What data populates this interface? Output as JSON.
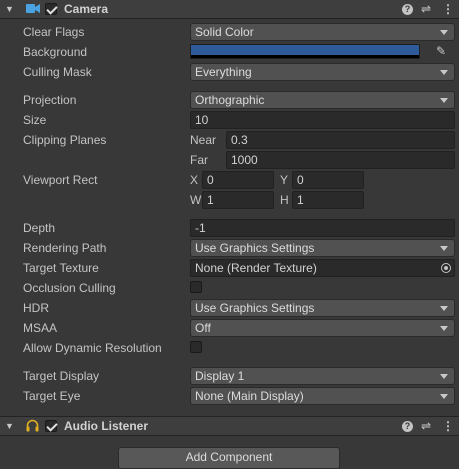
{
  "camera": {
    "title": "Camera",
    "enabled": true,
    "icons": [
      "camera-icon",
      "help-icon",
      "preset-icon",
      "more-icon"
    ],
    "clear_flags": {
      "label": "Clear Flags",
      "value": "Solid Color"
    },
    "background": {
      "label": "Background",
      "color": "#2f5a99"
    },
    "culling_mask": {
      "label": "Culling Mask",
      "value": "Everything"
    },
    "projection": {
      "label": "Projection",
      "value": "Orthographic"
    },
    "size": {
      "label": "Size",
      "value": "10"
    },
    "clipping": {
      "label": "Clipping Planes",
      "near_label": "Near",
      "near": "0.3",
      "far_label": "Far",
      "far": "1000"
    },
    "viewport": {
      "label": "Viewport Rect",
      "x_label": "X",
      "x": "0",
      "y_label": "Y",
      "y": "0",
      "w_label": "W",
      "w": "1",
      "h_label": "H",
      "h": "1"
    },
    "depth": {
      "label": "Depth",
      "value": "-1"
    },
    "rendering_path": {
      "label": "Rendering Path",
      "value": "Use Graphics Settings"
    },
    "target_texture": {
      "label": "Target Texture",
      "value": "None (Render Texture)"
    },
    "occlusion_culling": {
      "label": "Occlusion Culling",
      "checked": false
    },
    "hdr": {
      "label": "HDR",
      "value": "Use Graphics Settings"
    },
    "msaa": {
      "label": "MSAA",
      "value": "Off"
    },
    "dynamic_resolution": {
      "label": "Allow Dynamic Resolution",
      "checked": false
    },
    "target_display": {
      "label": "Target Display",
      "value": "Display 1"
    },
    "target_eye": {
      "label": "Target Eye",
      "value": "None (Main Display)"
    }
  },
  "audio_listener": {
    "title": "Audio Listener",
    "enabled": true,
    "icons": [
      "headphones-icon",
      "help-icon",
      "preset-icon",
      "more-icon"
    ]
  },
  "add_component": {
    "label": "Add Component"
  },
  "colors": {
    "panel": "#383838",
    "header": "#3e3e3e",
    "accent_camera": "#4aa3e0",
    "accent_audio": "#e0b020",
    "background_color": "#2f5a99"
  }
}
